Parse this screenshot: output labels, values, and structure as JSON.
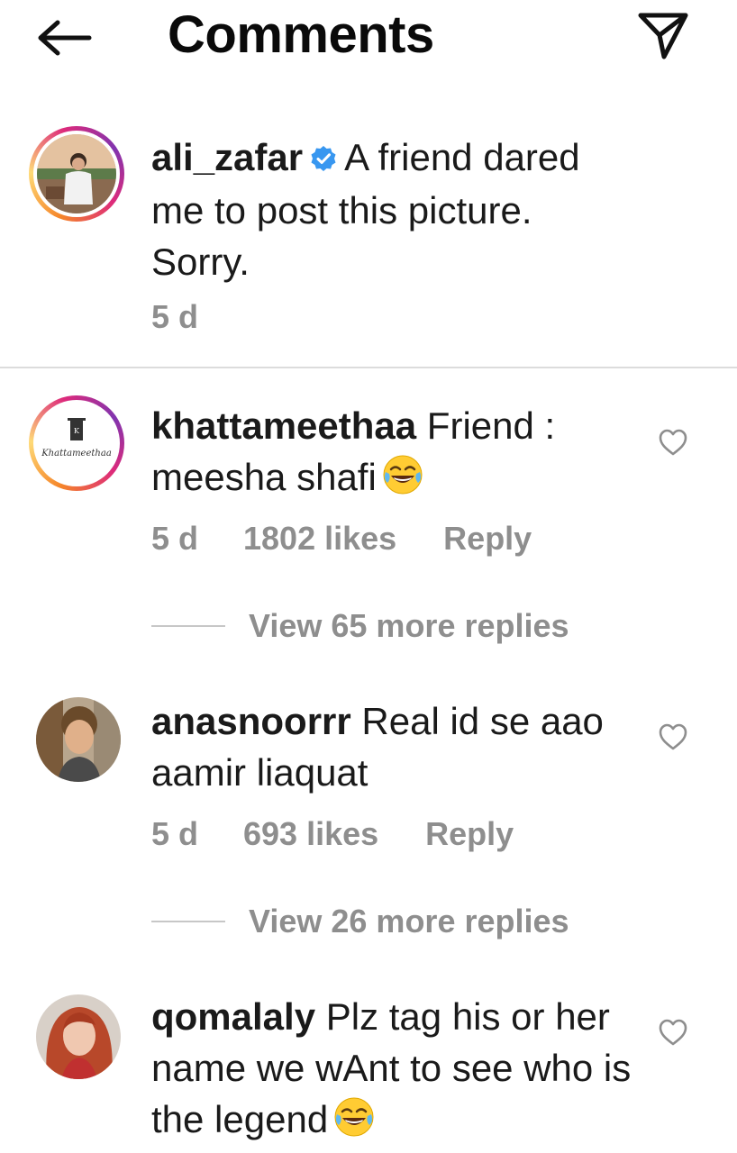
{
  "header": {
    "title": "Comments",
    "back_icon": "arrow-left-icon",
    "send_icon": "paper-plane-icon"
  },
  "caption": {
    "username": "ali_zafar",
    "verified": true,
    "text": "A friend dared me to post this picture. Sorry.",
    "time": "5 d"
  },
  "comments": [
    {
      "username": "khattameethaa",
      "text": "Friend : meesha shafi",
      "emoji": "face-with-tears-of-joy",
      "time": "5 d",
      "likes": "1802 likes",
      "reply_label": "Reply",
      "view_replies": "View 65 more replies",
      "avatar_text": "Khattameethaa"
    },
    {
      "username": "anasnoorrr",
      "text": "Real id se aao aamir liaquat",
      "time": "5 d",
      "likes": "693 likes",
      "reply_label": "Reply",
      "view_replies": "View 26 more replies"
    },
    {
      "username": "qomalaly",
      "text": "Plz tag his or her name we wAnt to see who is the legend",
      "emoji": "face-with-tears-of-joy"
    }
  ],
  "colors": {
    "text": "#1a1a1a",
    "secondary": "#8e8e8e",
    "divider": "#dcdcdc",
    "verified": "#3897f0"
  }
}
